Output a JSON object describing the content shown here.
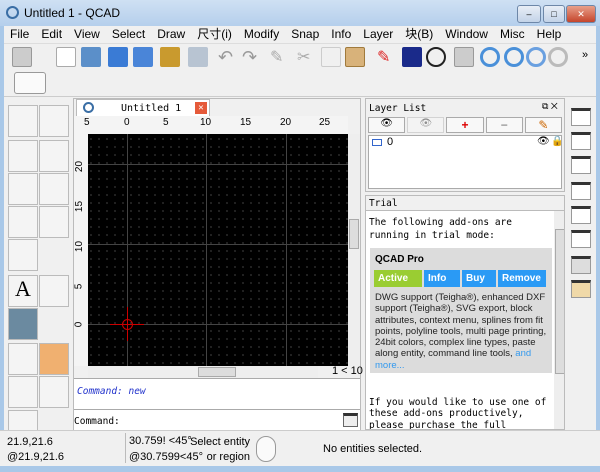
{
  "window": {
    "title": "Untitled 1 - QCAD"
  },
  "menu": [
    "File",
    "Edit",
    "View",
    "Select",
    "Draw",
    "尺寸(i)",
    "Modify",
    "Snap",
    "Info",
    "Layer",
    "块(B)",
    "Window",
    "Misc",
    "Help"
  ],
  "toolbar": {
    "overflow": "»",
    "icons": [
      "select-icon",
      "new-file-icon",
      "open-icon",
      "save-icon",
      "save-as-icon",
      "svg-export-icon",
      "print-preview-icon",
      "undo-icon",
      "redo-icon",
      "eraser-icon",
      "cut-icon",
      "copy-icon",
      "paste-icon",
      "pen-icon",
      "background-icon",
      "no-color-icon",
      "grid-icon",
      "zoom-in-icon",
      "zoom-out-icon",
      "zoom-auto-icon",
      "zoom-window-icon"
    ]
  },
  "document": {
    "tab_title": "Untitled 1",
    "h_ruler": [
      "5",
      "0",
      "5",
      "10",
      "15",
      "20",
      "25"
    ],
    "v_ruler": [
      "20",
      "15",
      "10",
      "5",
      "0"
    ],
    "page_indicator": "1 < 10"
  },
  "command": {
    "history": "Command: new",
    "prompt": "Command:"
  },
  "layer_list": {
    "title": "Layer List",
    "layers": [
      {
        "name": "0"
      }
    ]
  },
  "trial": {
    "title": "Trial",
    "intro": "The following add-ons are running in trial mode:",
    "product": "QCAD Pro",
    "buttons": [
      "Active",
      "Info",
      "Buy",
      "Remove"
    ],
    "description": "DWG support (Teigha®), enhanced DXF support (Teigha®), SVG export, block attributes, context menu, splines from fit points, polyline tools, multi page printing, 24bit colors, complex line types, paste along entity, command line tools,",
    "more_link": "and more...",
    "outro": "If you would like to use one of these add-ons productively, please purchase the full version for a small license"
  },
  "status": {
    "abs": "21.9,21.6",
    "rel": "@21.9,21.6",
    "polar": "30.759! <45°",
    "rel_polar": "@30.7599<45°",
    "hint": "Select entity or region",
    "selection": "No entities selected."
  },
  "colors": {
    "active": "#9acd32",
    "button": "#2a9af5",
    "canvas": "#000000",
    "crosshair": "#cc0000"
  }
}
